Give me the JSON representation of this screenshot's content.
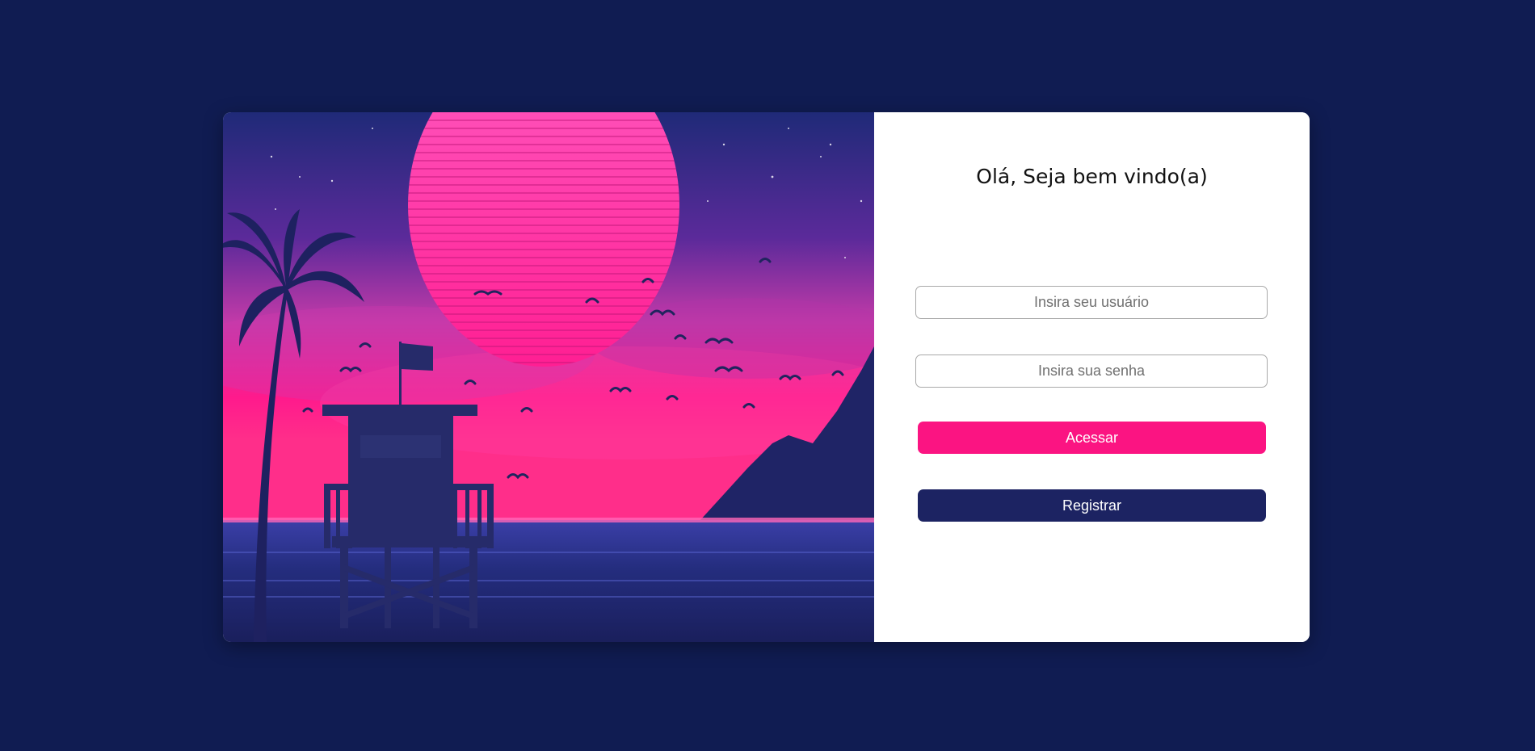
{
  "colors": {
    "page_background": "#101c52",
    "accent_pink": "#fb1482",
    "navy_button": "#1c2362"
  },
  "hero": {
    "icon": "synthwave-beach-sunset-illustration"
  },
  "login": {
    "title": "Olá, Seja bem vindo(a)",
    "username_placeholder": "Insira seu usuário",
    "password_placeholder": "Insira sua senha",
    "login_label": "Acessar",
    "register_label": "Registrar"
  }
}
